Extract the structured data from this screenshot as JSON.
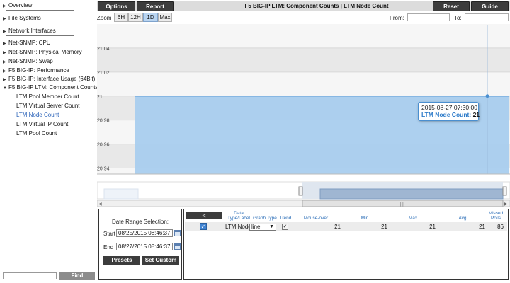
{
  "sidebar": {
    "items": [
      {
        "label": "Overview",
        "expanded": false
      },
      {
        "label": "File Systems",
        "expanded": false
      },
      {
        "label": "Network Interfaces",
        "expanded": false
      },
      {
        "label": "Net-SNMP: CPU",
        "expanded": false
      },
      {
        "label": "Net-SNMP: Physical Memory",
        "expanded": false
      },
      {
        "label": "Net-SNMP: Swap",
        "expanded": false
      },
      {
        "label": "F5 BIG-IP: Performance",
        "expanded": false
      },
      {
        "label": "F5 BIG-IP: Interface Usage (64Bit)",
        "expanded": false
      },
      {
        "label": "F5 BIG-IP LTM: Component Counts",
        "expanded": true
      }
    ],
    "subitems": [
      {
        "label": "LTM Pool Member Count"
      },
      {
        "label": "LTM Virtual Server Count"
      },
      {
        "label": "LTM Node Count",
        "active": true
      },
      {
        "label": "LTM Virtual IP Count"
      },
      {
        "label": "LTM Pool Count"
      }
    ],
    "find_label": "Find"
  },
  "toolbar": {
    "options_label": "Options",
    "report_label": "Report",
    "title": "F5 BIG-IP LTM: Component Counts | LTM Node Count",
    "reset_label": "Reset",
    "guide_label": "Guide"
  },
  "zoom": {
    "label": "Zoom",
    "options": [
      "6H",
      "12H",
      "1D",
      "Max"
    ],
    "selected": "1D",
    "from_label": "From:",
    "to_label": "To:"
  },
  "chart_data": {
    "type": "area",
    "ytick_labels": [
      "21.04",
      "21.02",
      "21",
      "20.98",
      "20.96",
      "20.94"
    ],
    "yticks": [
      21.04,
      21.02,
      21.0,
      20.98,
      20.96,
      20.94
    ],
    "ylim": [
      20.935,
      21.06
    ],
    "series": [
      {
        "name": "LTM Node Count",
        "value": 21
      }
    ],
    "grid": true,
    "tooltip": {
      "date": "2015-08-27 07:30:00",
      "series": "LTM Node Count",
      "value": "21"
    }
  },
  "colors": {
    "series_fill": "#a9cdee",
    "series_line": "#4a8fd0",
    "band_dark": "#e8e8e8",
    "band_light": "#f6f6f6",
    "accent_link": "#2a62b8",
    "button_dark": "#3c3c3c"
  },
  "date_panel": {
    "title": "Date Range Selection:",
    "start_label": "Start",
    "start_value": "08/25/2015 08:46:37",
    "end_label": "End",
    "end_value": "08/27/2015 08:46:37",
    "presets_label": "Presets",
    "set_custom_label": "Set Custom"
  },
  "data_table": {
    "back_label": "<",
    "headers": {
      "data_type": "Data Type/Label",
      "graph_type": "Graph Type",
      "trend": "Trend",
      "mouse_over": "Mouse-over",
      "min": "Min",
      "max": "Max",
      "avg": "Avg",
      "missed_polls": "Missed Polls"
    },
    "row": {
      "label": "LTM Node",
      "graph_type": "line",
      "mouse_over": "21",
      "min": "21",
      "max": "21",
      "avg": "21",
      "missed_polls": "86"
    }
  }
}
